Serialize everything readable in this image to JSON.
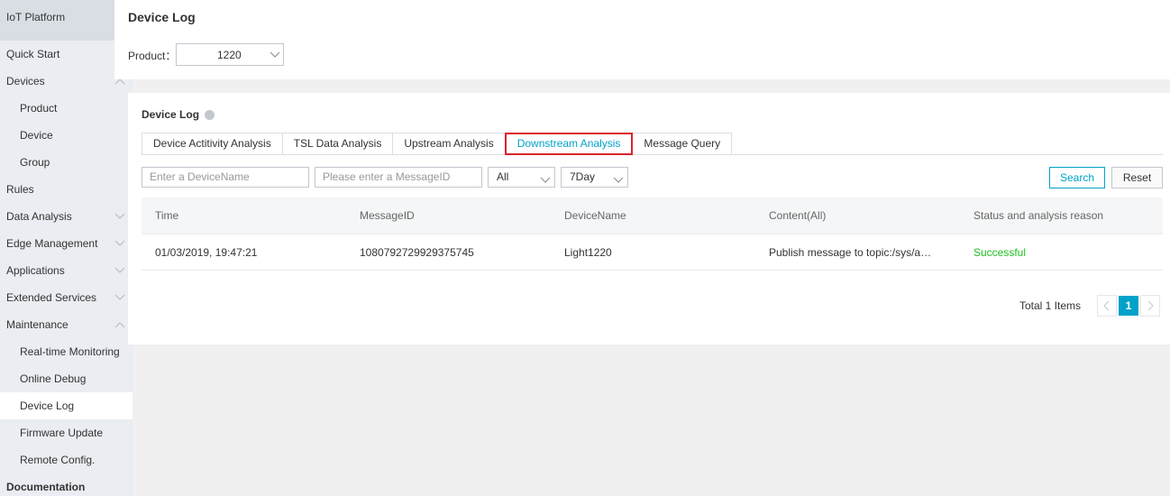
{
  "sidebar": {
    "brand": "IoT Platform",
    "items": [
      {
        "label": "Quick Start"
      },
      {
        "label": "Devices"
      },
      {
        "label": "Product"
      },
      {
        "label": "Device"
      },
      {
        "label": "Group"
      },
      {
        "label": "Rules"
      },
      {
        "label": "Data Analysis"
      },
      {
        "label": "Edge Management"
      },
      {
        "label": "Applications"
      },
      {
        "label": "Extended Services"
      },
      {
        "label": "Maintenance"
      },
      {
        "label": "Real-time Monitoring"
      },
      {
        "label": "Online Debug"
      },
      {
        "label": "Device Log"
      },
      {
        "label": "Firmware Update"
      },
      {
        "label": "Remote Config."
      },
      {
        "label": "Documentation"
      }
    ]
  },
  "header": {
    "title": "Device Log",
    "product_label": "Product：",
    "product_value": "1220"
  },
  "panel": {
    "title": "Device Log",
    "tabs": [
      {
        "label": "Device Actitivity Analysis"
      },
      {
        "label": "TSL Data Analysis"
      },
      {
        "label": "Upstream Analysis"
      },
      {
        "label": "Downstream Analysis",
        "active": true
      },
      {
        "label": "Message Query"
      }
    ],
    "filters": {
      "device_placeholder": "Enter a DeviceName",
      "message_placeholder": "Please enter a MessageID",
      "status_value": "All",
      "range_value": "7Day",
      "search_label": "Search",
      "reset_label": "Reset"
    },
    "table": {
      "columns": [
        "Time",
        "MessageID",
        "DeviceName",
        "Content(All)",
        "Status and analysis reason"
      ],
      "rows": [
        [
          "01/03/2019, 19:47:21",
          "1080792729929375745",
          "Light1220",
          "Publish message to topic:/sys/a18…",
          "Successful"
        ]
      ]
    },
    "pagination": {
      "total_text": "Total 1 Items",
      "current_page": "1"
    }
  },
  "colors": {
    "accent": "#00a2c9",
    "success": "#1dc11d",
    "highlight_border": "#d9232d"
  }
}
